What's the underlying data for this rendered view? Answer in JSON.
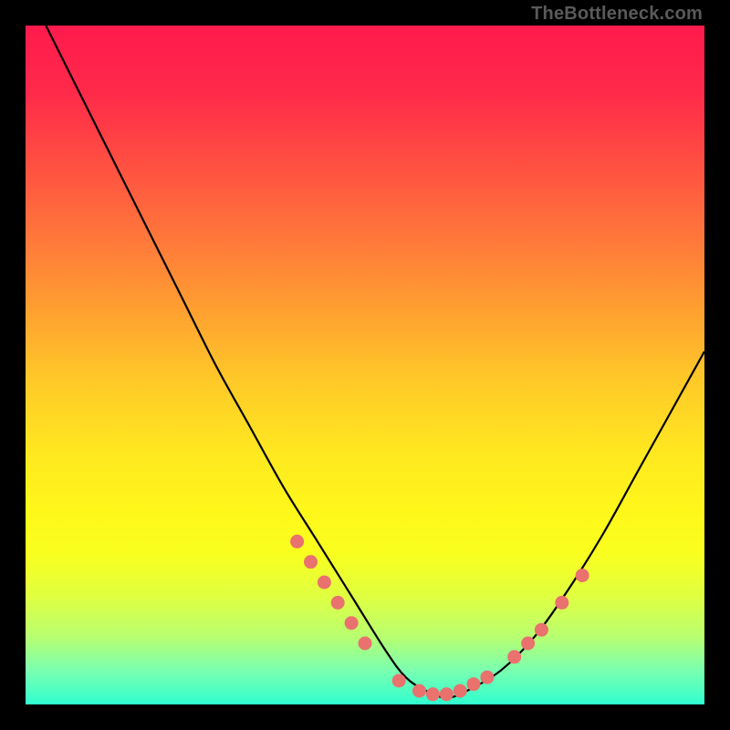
{
  "watermark": "TheBottleneck.com",
  "chart_data": {
    "type": "line",
    "title": "",
    "xlabel": "",
    "ylabel": "",
    "xlim": [
      0,
      100
    ],
    "ylim": [
      0,
      100
    ],
    "grid": false,
    "series": [
      {
        "name": "bottleneck-curve",
        "x": [
          3,
          8,
          13,
          18,
          23,
          28,
          33,
          38,
          43,
          48,
          53,
          56,
          59,
          62,
          65,
          70,
          75,
          80,
          85,
          90,
          95,
          100
        ],
        "y": [
          100,
          90,
          80,
          70,
          60,
          50,
          41,
          32,
          24,
          16,
          8,
          4,
          2,
          1,
          2,
          5,
          10,
          17,
          25,
          34,
          43,
          52
        ]
      }
    ],
    "markers": [
      {
        "name": "left-cluster",
        "x": [
          40,
          42,
          44,
          46,
          48,
          50
        ],
        "y": [
          24,
          21,
          18,
          15,
          12,
          9
        ]
      },
      {
        "name": "valley-cluster",
        "x": [
          55,
          58,
          60,
          62,
          64,
          66,
          68
        ],
        "y": [
          3.5,
          2,
          1.5,
          1.5,
          2,
          3,
          4
        ]
      },
      {
        "name": "right-cluster",
        "x": [
          72,
          74,
          76,
          79,
          82
        ],
        "y": [
          7,
          9,
          11,
          15,
          19
        ]
      }
    ],
    "colors": {
      "curve": "#000000",
      "dots": "#e9716e",
      "top_gradient": "#ff1a4d",
      "bottom_gradient": "#30ffd0"
    }
  }
}
